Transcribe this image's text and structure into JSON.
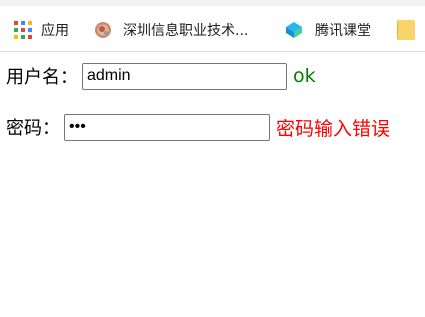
{
  "bookmarks": {
    "apps_label": "应用",
    "item1_label": "深圳信息职业技术...",
    "item2_label": "腾讯课堂"
  },
  "form": {
    "username_label": "用户名：",
    "username_value": "admin",
    "username_message": "ok",
    "password_label": "密码：",
    "password_value": "abc",
    "password_message": "密码输入错误"
  },
  "colors": {
    "ok": "#008000",
    "error": "#ff0000"
  }
}
